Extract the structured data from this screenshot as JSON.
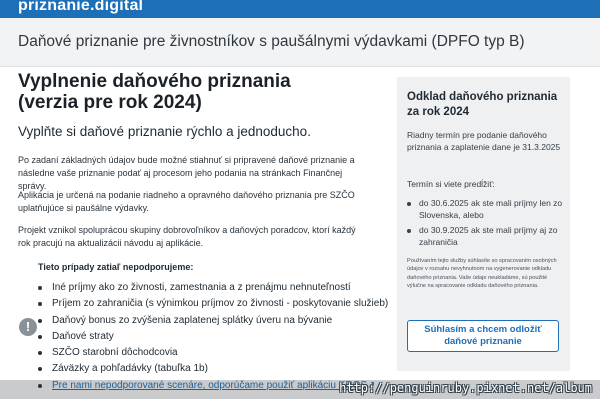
{
  "brand": "priznanie.digital",
  "header": {
    "title": "Daňové priznanie pre živnostníkov s paušálnymi výdavkami (DPFO typ B)"
  },
  "main": {
    "title_line1": "Vyplnenie daňového priznania",
    "title_line2": "(verzia pre rok 2024)",
    "lead": "Vyplňte si daňové priznanie rýchlo a jednoducho.",
    "paragraphs": [
      "Po zadaní základných údajov bude možné stiahnuť si pripravené daňové priznanie a následne vaše priznanie podať aj procesom jeho podania na stránkach Finančnej správy.",
      "Aplikácia je určená na podanie riadneho a opravného daňového priznania pre SZČO uplatňujúce si paušálne výdavky.",
      "Projekt vznikol spoluprácou skupiny dobrovoľníkov a daňových poradcov, ktorí každý rok pracujú na aktualizácii návodu aj aplikácie."
    ],
    "unsupported": {
      "heading": "Tieto prípady zatiaľ nepodporujeme:",
      "items": [
        "Iné príjmy ako zo živnosti, zamestnania a z prenájmu nehnuteľností",
        "Príjem zo zahraničia (s výnimkou príjmov zo živnosti - poskytovanie služieb)",
        "Daňový bonus zo zvýšenia zaplatenej splátky úveru na bývanie",
        "Daňové straty",
        "SZČO starobní dôchodcovia",
        "Záväzky a pohľadávky (tabuľka 1b)"
      ],
      "link_text": "Pre nami nepodporované scenáre, odporúčame použiť aplikáciu KROS"
    }
  },
  "sidebar": {
    "title": "Odklad daňového priznania za rok 2024",
    "deadline": "Riadny termín pre podanie daňového priznania a zaplatenie dane je 31.3.2025",
    "extend_label": "Termín si viete predĺžiť:",
    "extend_items": [
      "do 30.6.2025 ak ste mali príjmy len zo Slovenska, alebo",
      "do 30.9.2025 ak ste mali príjmy aj zo zahraničia"
    ],
    "consent": "Používaním tejto služby súhlasíte so spracovaním osobných údajov v rozsahu nevyhnutnom na vygenerovanie odkladu daňového priznania. Vaše údaje neukladáme, sú použité výlučne na spracovanie odkladu daňového priznania.",
    "button_label": "Súhlasím a chcem odložiť\ndaňové priznanie"
  },
  "icons": {
    "warning": "exclamation-circle-icon"
  },
  "colors": {
    "brand_blue": "#1d6fb8",
    "sidebar_bg": "#eef0f2",
    "subheader_bg": "#f2f3f5"
  },
  "watermark": "http://penguinruby.pixnet.net/album"
}
